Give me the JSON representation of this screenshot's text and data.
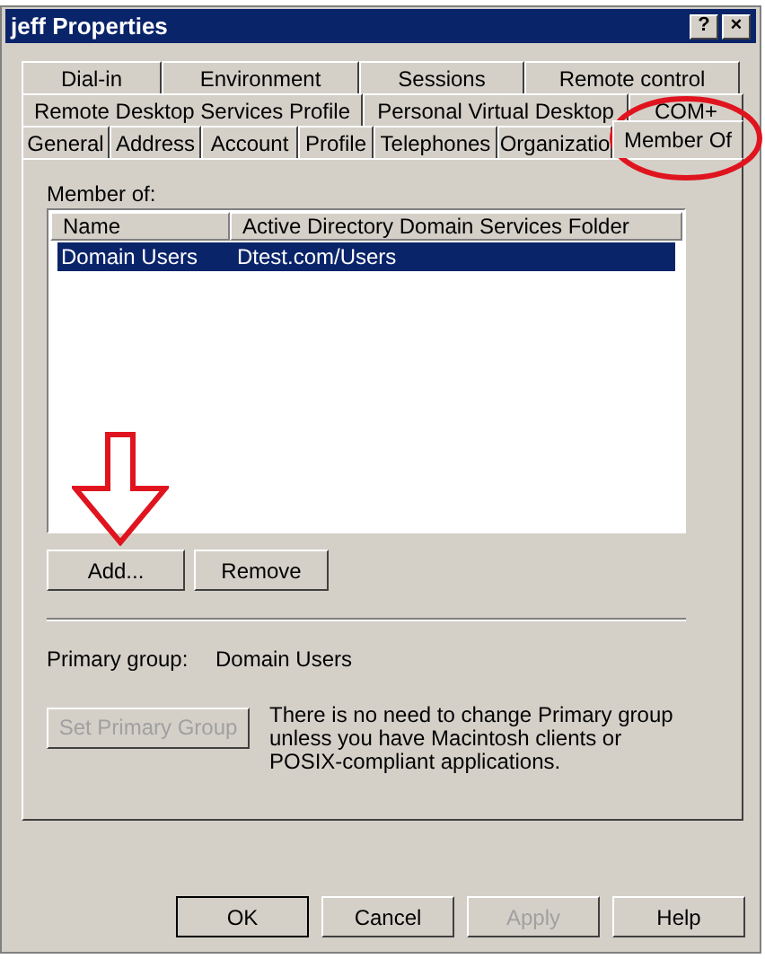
{
  "window": {
    "title": "jeff Properties",
    "controls": [
      "?",
      "×"
    ]
  },
  "tab_rows": [
    [
      {
        "label": "Dial-in",
        "selected": false
      },
      {
        "label": "Environment",
        "selected": false
      },
      {
        "label": "Sessions",
        "selected": false
      },
      {
        "label": "Remote control",
        "selected": false
      }
    ],
    [
      {
        "label": "Remote Desktop Services Profile",
        "selected": false
      },
      {
        "label": "Personal Virtual Desktop",
        "selected": false
      },
      {
        "label": "COM+",
        "selected": false
      }
    ],
    [
      {
        "label": "General",
        "selected": false
      },
      {
        "label": "Address",
        "selected": false
      },
      {
        "label": "Account",
        "selected": false
      },
      {
        "label": "Profile",
        "selected": false
      },
      {
        "label": "Telephones",
        "selected": false
      },
      {
        "label": "Organizatio",
        "selected": false
      },
      {
        "label": "Member Of",
        "selected": true
      }
    ]
  ],
  "member_of": {
    "label": "Member of:",
    "columns": [
      "Name",
      "Active Directory Domain Services Folder"
    ],
    "rows": [
      {
        "cells": [
          "Domain Users",
          "Dtest.com/Users"
        ],
        "selected": true
      }
    ],
    "buttons": [
      {
        "label": "Add...",
        "disabled": false
      },
      {
        "label": "Remove",
        "disabled": false
      }
    ]
  },
  "primary_group": {
    "label": "Primary group:",
    "value": "Domain Users",
    "button": {
      "label": "Set Primary Group",
      "disabled": true
    },
    "note": "There is no need to change Primary group unless you have Macintosh clients or POSIX-compliant applications."
  },
  "dialog_buttons": [
    {
      "label": "OK",
      "disabled": false,
      "default": true
    },
    {
      "label": "Cancel",
      "disabled": false,
      "default": false
    },
    {
      "label": "Apply",
      "disabled": true,
      "default": false
    },
    {
      "label": "Help",
      "disabled": false,
      "default": false
    }
  ]
}
